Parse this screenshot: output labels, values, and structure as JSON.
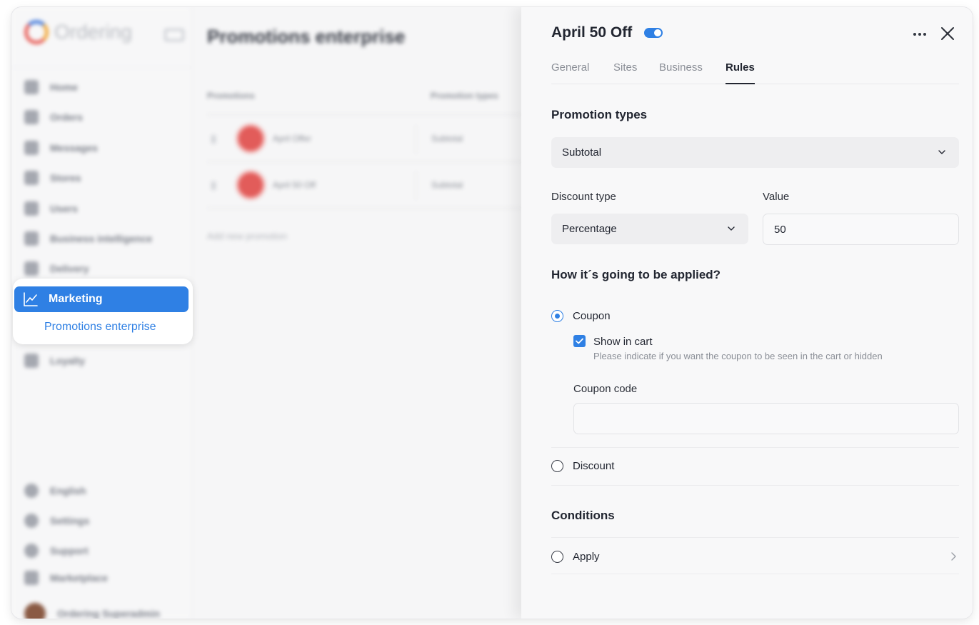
{
  "background": {
    "logo_text": "Ordering",
    "nav": [
      "Home",
      "Orders",
      "Messages",
      "Stores",
      "Users",
      "Business intelligence",
      "Delivery",
      "Loyalty"
    ],
    "bottom_nav": [
      "English",
      "Settings",
      "Support",
      "Marketplace",
      "Ordering Superadmin"
    ],
    "page_title": "Promotions enterprise",
    "table_headers": [
      "Promotions",
      "Promotion types"
    ],
    "rows": [
      {
        "name": "April Offer",
        "type": "Subtotal"
      },
      {
        "name": "April 50 Off",
        "type": "Subtotal"
      }
    ],
    "add_label": "Add new promotion"
  },
  "menu": {
    "active_label": "Marketing",
    "sub_label": "Promotions enterprise"
  },
  "drawer": {
    "title": "April 50 Off",
    "enabled": true,
    "tabs": [
      {
        "label": "General"
      },
      {
        "label": "Sites"
      },
      {
        "label": "Business"
      },
      {
        "label": "Rules"
      }
    ],
    "active_tab": "Rules",
    "promotion_types": {
      "title": "Promotion types",
      "selected": "Subtotal"
    },
    "discount_type": {
      "label": "Discount type",
      "selected": "Percentage"
    },
    "value": {
      "label": "Value",
      "value": "50"
    },
    "application": {
      "title": "How it´s going to be applied?",
      "coupon_label": "Coupon",
      "coupon_selected": true,
      "show_in_cart_label": "Show in cart",
      "show_in_cart_checked": true,
      "show_in_cart_hint": "Please indicate if you want the coupon to be seen in the cart or hidden",
      "coupon_code_label": "Coupon code",
      "coupon_code_value": "",
      "discount_label": "Discount",
      "discount_selected": false
    },
    "conditions": {
      "title": "Conditions",
      "apply_label": "Apply",
      "apply_selected": false
    }
  },
  "colors": {
    "accent": "#2f80e4",
    "text": "#222631",
    "muted": "#8a8e96"
  }
}
